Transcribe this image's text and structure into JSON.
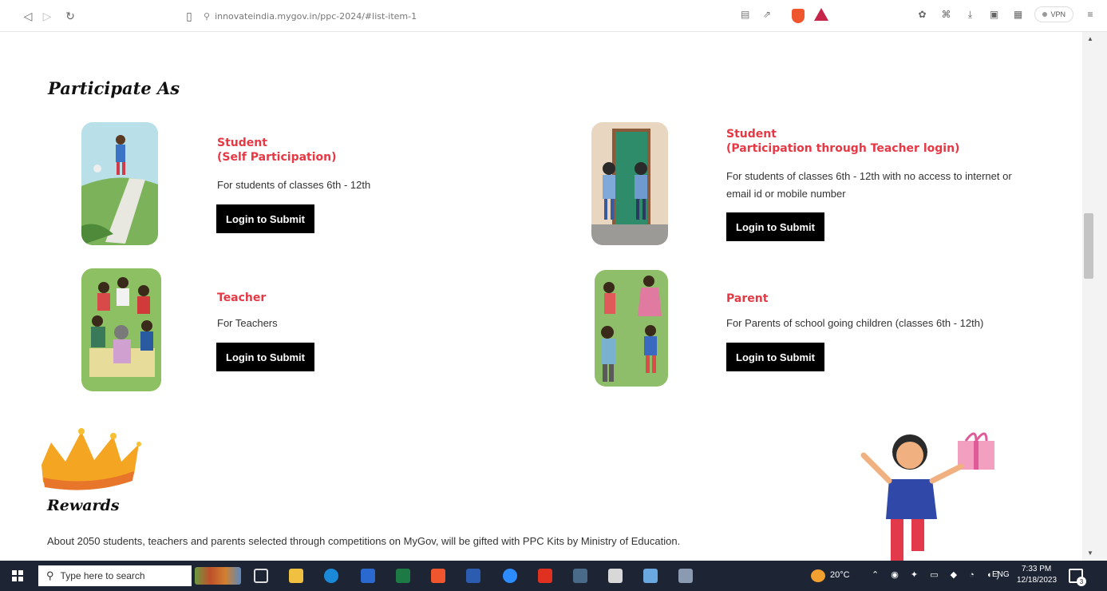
{
  "browser": {
    "url": "innovateindia.mygov.in/ppc-2024/#list-item-1",
    "vpn_label": "VPN"
  },
  "participate": {
    "heading": "Participate As",
    "cards": [
      {
        "title_line1": "Student",
        "title_line2": "(Self Participation)",
        "description": "For students of classes 6th - 12th",
        "button": "Login to Submit"
      },
      {
        "title_line1": "Student",
        "title_line2": "(Participation through Teacher login)",
        "description_line1": "For students of classes 6th - 12th with no access to internet or",
        "description_line2": "email id or mobile number",
        "button": "Login to Submit"
      },
      {
        "title_line1": "Teacher",
        "description": "For Teachers",
        "button": "Login to Submit"
      },
      {
        "title_line1": "Parent",
        "description": "For Parents of school going children (classes 6th - 12th)",
        "button": "Login to Submit"
      }
    ]
  },
  "rewards": {
    "heading": "Rewards",
    "text": "About 2050 students, teachers and parents selected through competitions on MyGov, will be gifted with PPC Kits by Ministry of Education."
  },
  "taskbar": {
    "search_placeholder": "Type here to search",
    "weather": "20°C",
    "language": "ENG",
    "time": "7:33 PM",
    "date": "12/18/2023",
    "notifications": "3"
  },
  "colors": {
    "accent_red": "#e63845",
    "button_black": "#000000",
    "taskbar": "#1d2535"
  }
}
